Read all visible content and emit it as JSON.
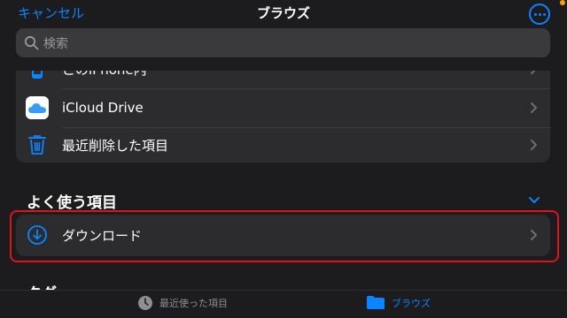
{
  "header": {
    "cancel_label": "キャンセル",
    "title": "ブラウズ",
    "more_icon": "ellipsis-circle-icon"
  },
  "search": {
    "placeholder": "検索",
    "icon": "search-icon"
  },
  "locations": [
    {
      "label": "このiPhone内",
      "icon": "iphone-icon"
    },
    {
      "label": "iCloud Drive",
      "icon": "icloud-icon"
    },
    {
      "label": "最近削除した項目",
      "icon": "trash-icon"
    }
  ],
  "favorites": {
    "heading": "よく使う項目",
    "items": [
      {
        "label": "ダウンロード",
        "icon": "download-circle-icon"
      }
    ]
  },
  "tags": {
    "heading": "タグ"
  },
  "tabbar": {
    "recent_label": "最近使った項目",
    "browse_label": "ブラウズ"
  },
  "colors": {
    "accent": "#0a84ff",
    "background": "#1c1c1e",
    "row_background": "#2c2c2e",
    "highlight": "#e0121a"
  }
}
